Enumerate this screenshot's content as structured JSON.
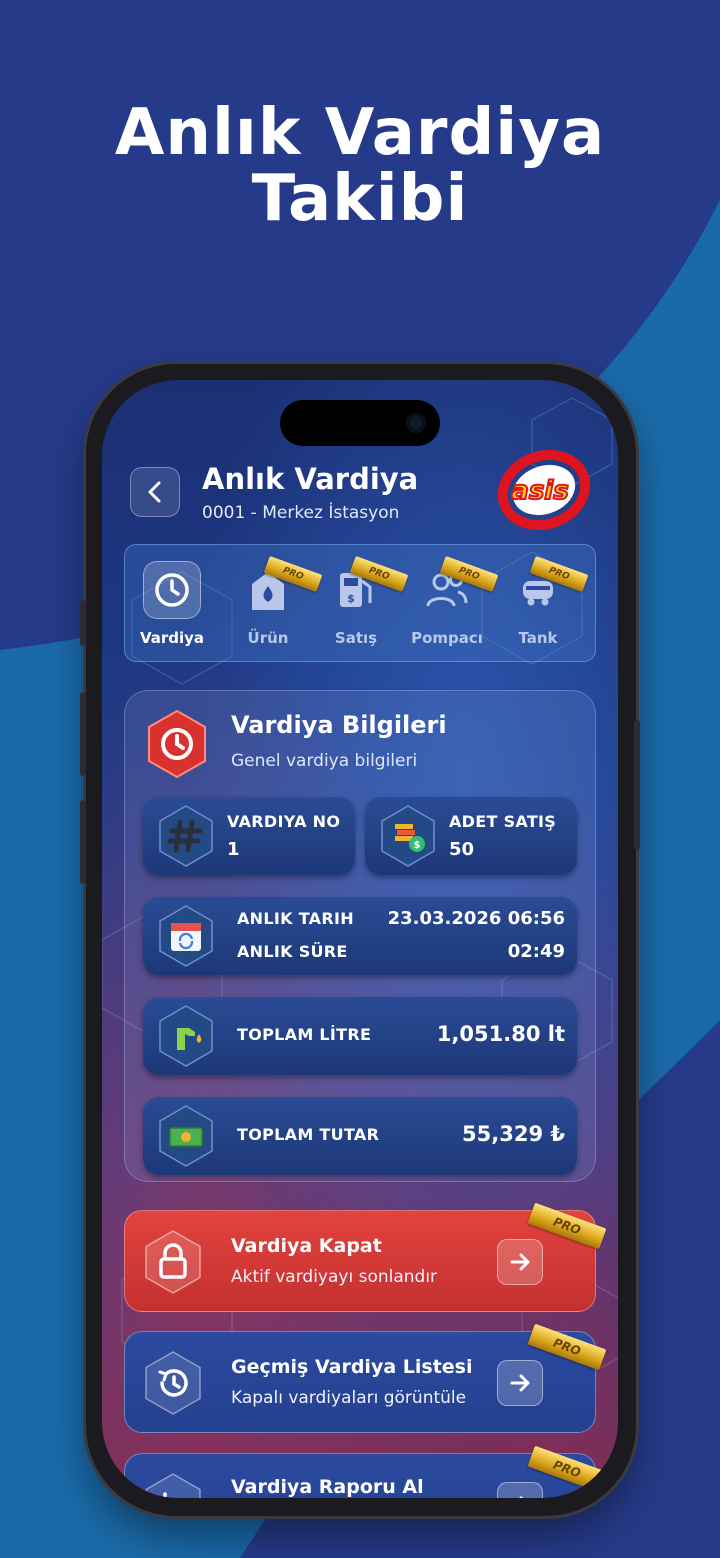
{
  "promo": {
    "line1": "Anlık Vardiya",
    "line2": "Takibi"
  },
  "header": {
    "title": "Anlık Vardiya",
    "subtitle": "0001 - Merkez İstasyon",
    "brand": "asis"
  },
  "tabs": [
    {
      "label": "Vardiya",
      "icon": "clock-icon",
      "active": true,
      "pro": false
    },
    {
      "label": "Ürün",
      "icon": "fuel-drop-icon",
      "active": false,
      "pro": true
    },
    {
      "label": "Satış",
      "icon": "fuel-pump-icon",
      "active": false,
      "pro": true
    },
    {
      "label": "Pompacı",
      "icon": "users-icon",
      "active": false,
      "pro": true
    },
    {
      "label": "Tank",
      "icon": "tank-truck-icon",
      "active": false,
      "pro": true
    }
  ],
  "pro_badge": "PRO",
  "info": {
    "title": "Vardiya Bilgileri",
    "subtitle": "Genel vardiya bilgileri",
    "vardiya_no_label": "VARDIYA NO",
    "vardiya_no_value": "1",
    "adet_satis_label": "ADET SATIŞ",
    "adet_satis_value": "50",
    "anlik_tarih_label": "ANLIK TARIH",
    "anlik_tarih_value": "23.03.2026 06:56",
    "anlik_sure_label": "ANLIK SÜRE",
    "anlik_sure_value": "02:49",
    "toplam_litre_label": "TOPLAM LİTRE",
    "toplam_litre_value": "1,051.80 lt",
    "toplam_tutar_label": "TOPLAM TUTAR",
    "toplam_tutar_value": "55,329 ₺"
  },
  "actions": [
    {
      "title": "Vardiya Kapat",
      "subtitle": "Aktif vardiyayı sonlandır",
      "icon": "lock-icon"
    },
    {
      "title": "Geçmiş Vardiya Listesi",
      "subtitle": "Kapalı vardiyaları görüntüle",
      "icon": "history-icon"
    },
    {
      "title": "Vardiya Raporu Al",
      "subtitle": "",
      "icon": "report-plus-icon"
    }
  ],
  "colors": {
    "background": "#263a8a",
    "accent_blue": "#1b6fae",
    "action_red": "#d63b37",
    "brand_red": "#e0141e",
    "brand_yellow": "#ffd21a"
  }
}
